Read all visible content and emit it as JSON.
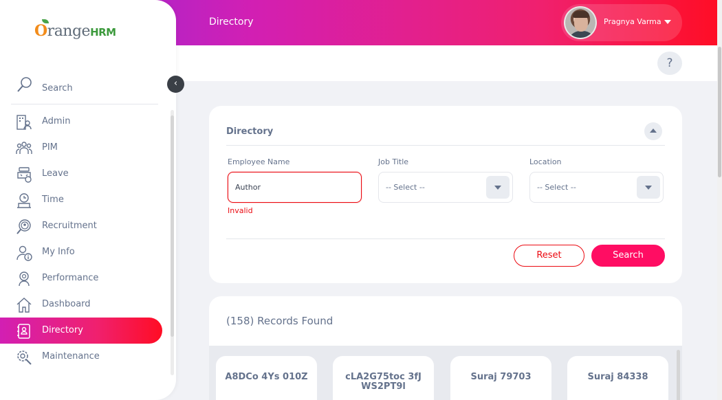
{
  "header": {
    "page_title": "Directory",
    "user_name": "Pragnya Varma"
  },
  "sidebar": {
    "brand_o": "O",
    "brand_range": "range",
    "brand_hrm": "HRM",
    "search_label": "Search",
    "items": [
      {
        "label": "Admin",
        "icon": "admin-icon",
        "active": false
      },
      {
        "label": "PIM",
        "icon": "pim-icon",
        "active": false
      },
      {
        "label": "Leave",
        "icon": "leave-icon",
        "active": false
      },
      {
        "label": "Time",
        "icon": "time-icon",
        "active": false
      },
      {
        "label": "Recruitment",
        "icon": "recruitment-icon",
        "active": false
      },
      {
        "label": "My Info",
        "icon": "my-info-icon",
        "active": false
      },
      {
        "label": "Performance",
        "icon": "performance-icon",
        "active": false
      },
      {
        "label": "Dashboard",
        "icon": "dashboard-icon",
        "active": false
      },
      {
        "label": "Directory",
        "icon": "directory-icon",
        "active": true
      },
      {
        "label": "Maintenance",
        "icon": "maintenance-icon",
        "active": false
      }
    ]
  },
  "help": {
    "label": "?"
  },
  "filter": {
    "title": "Directory",
    "employee_name": {
      "label": "Employee Name",
      "value": "Author",
      "error": "Invalid"
    },
    "job_title": {
      "label": "Job Title",
      "selected": "-- Select --"
    },
    "location": {
      "label": "Location",
      "selected": "-- Select --"
    },
    "reset_label": "Reset",
    "search_label": "Search"
  },
  "records": {
    "count_text": "(158) Records Found",
    "employees": [
      {
        "name": "A8DCo 4Ys 010Z"
      },
      {
        "name": "cLA2G75toc 3fJ WS2PT9l"
      },
      {
        "name": "Suraj 79703"
      },
      {
        "name": "Suraj 84338"
      }
    ]
  },
  "colors": {
    "accent": "#ff0d63",
    "error": "#eb0910",
    "text": "#64728c"
  }
}
